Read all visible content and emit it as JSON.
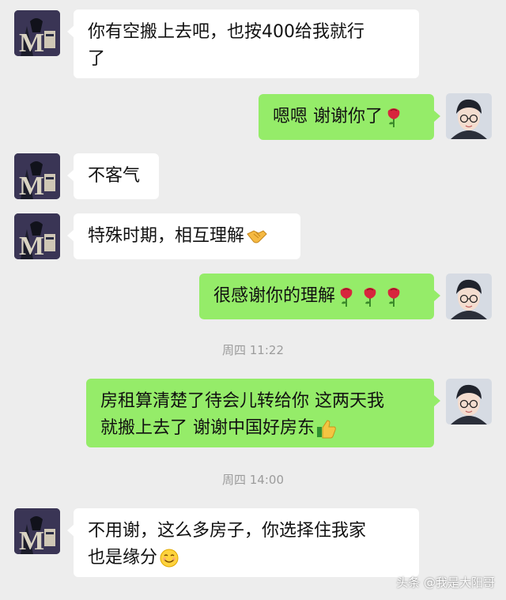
{
  "messages": [
    {
      "side": "in",
      "text": "你有空搬上去吧，也按400给我就行",
      "text2": "了",
      "icon": ""
    },
    {
      "side": "out",
      "text": "嗯嗯  谢谢你了",
      "icon": "rose-emoji"
    },
    {
      "side": "in",
      "text": "不客气",
      "icon": ""
    },
    {
      "side": "in",
      "text": "特殊时期，相互理解",
      "icon": "handshake-emoji"
    },
    {
      "side": "out",
      "text": "很感谢你的理解",
      "icon": "rose-emoji x3"
    },
    {
      "side": "out",
      "text": "房租算清楚了待会儿转给你  这两天我",
      "text2": "就搬上去了  谢谢中国好房东",
      "icon": "thumbs-up-emoji"
    },
    {
      "side": "in",
      "text": "不用谢，这么多房子，你选择住我家",
      "text2": "也是缘分",
      "icon": "smile-emoji"
    }
  ],
  "timestamps": [
    "周四 11:22",
    "周四 14:00"
  ],
  "watermark": "头条 @我是大阳哥",
  "colors": {
    "background": "#ededed",
    "incoming": "#ffffff",
    "outgoing": "#95ec69"
  }
}
